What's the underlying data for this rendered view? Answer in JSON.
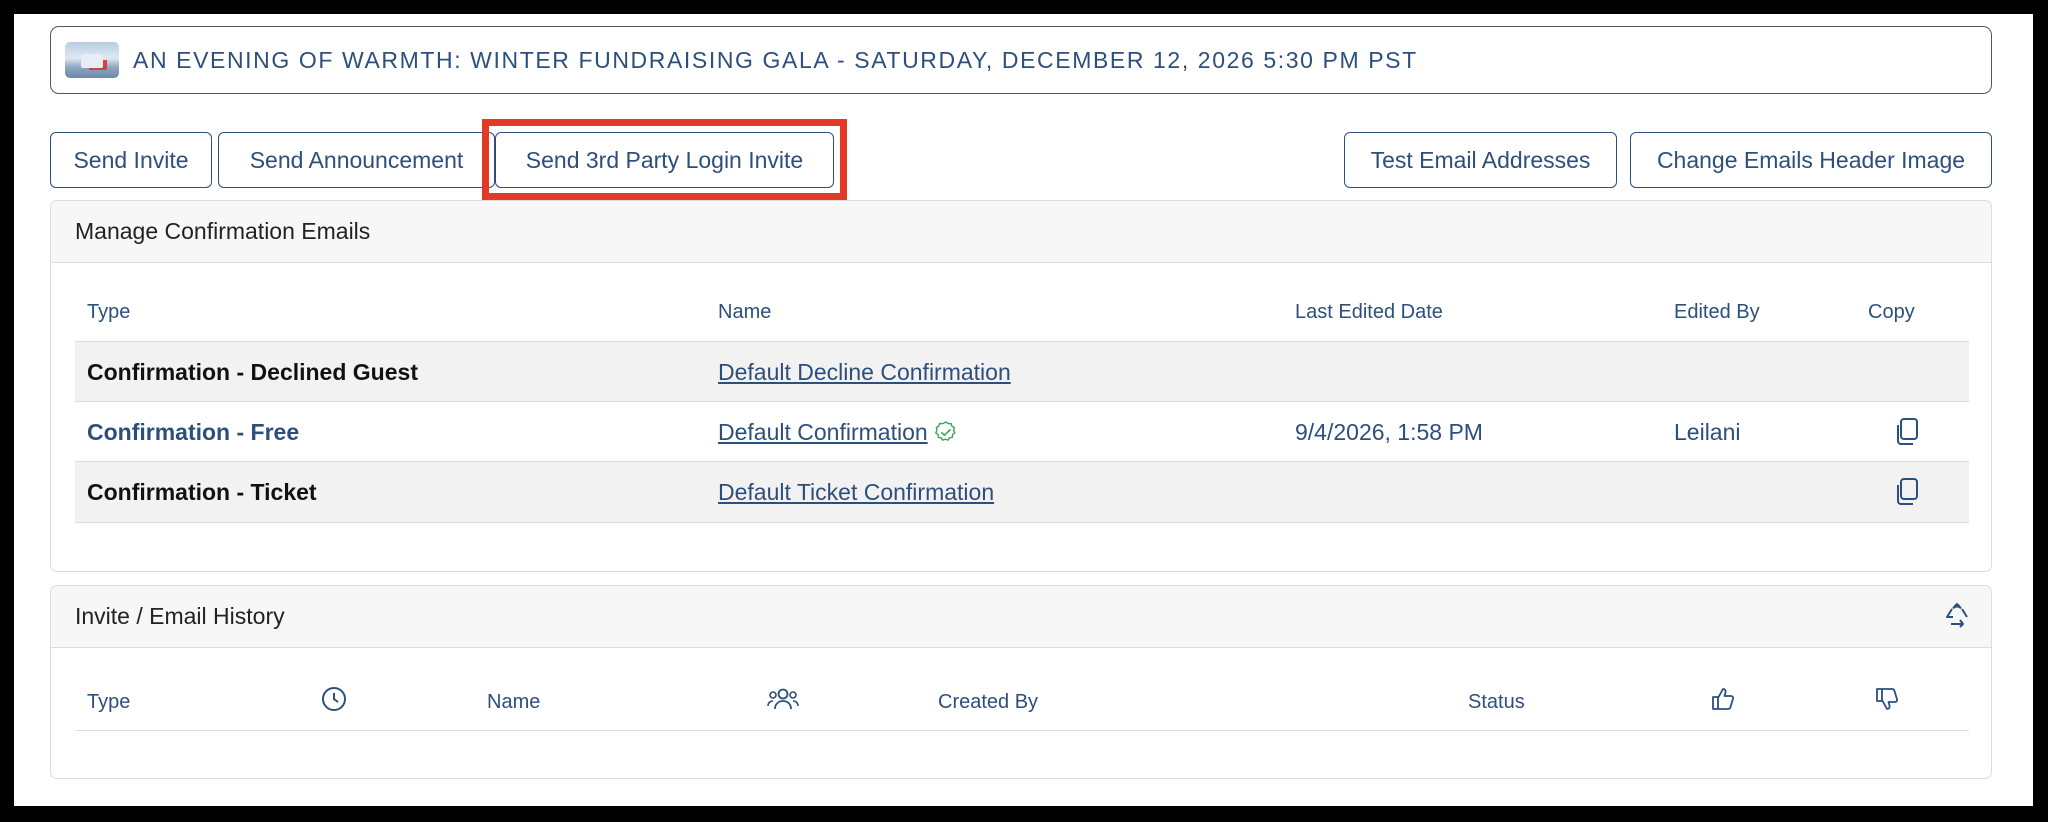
{
  "event": {
    "title": "AN EVENING OF WARMTH: WINTER FUNDRAISING GALA - SATURDAY, DECEMBER 12, 2026 5:30 PM PST"
  },
  "toolbar": {
    "send_invite": "Send Invite",
    "send_announcement": "Send Announcement",
    "send_3rd_party": "Send 3rd Party Login Invite",
    "test_email": "Test Email Addresses",
    "change_header": "Change Emails Header Image"
  },
  "confirmation_panel": {
    "title": "Manage Confirmation Emails",
    "columns": {
      "type": "Type",
      "name": "Name",
      "last_edited": "Last Edited Date",
      "edited_by": "Edited By",
      "copy": "Copy"
    },
    "rows": [
      {
        "type": "Confirmation - Declined Guest",
        "name": "Default Decline Confirmation ",
        "last_edited": "",
        "edited_by": ""
      },
      {
        "type": "Confirmation - Free",
        "name": "Default Confirmation ",
        "last_edited": "9/4/2026, 1:58 PM",
        "edited_by": "Leilani"
      },
      {
        "type": "Confirmation - Ticket",
        "name": "Default Ticket Confirmation ",
        "last_edited": "",
        "edited_by": ""
      }
    ]
  },
  "history_panel": {
    "title": "Invite / Email History",
    "columns": {
      "type": "Type",
      "name": "Name",
      "created_by": "Created By",
      "status": "Status"
    }
  },
  "colors": {
    "accent": "#2d4f7c",
    "highlight": "#e23a24",
    "verified": "#3aa55b"
  }
}
